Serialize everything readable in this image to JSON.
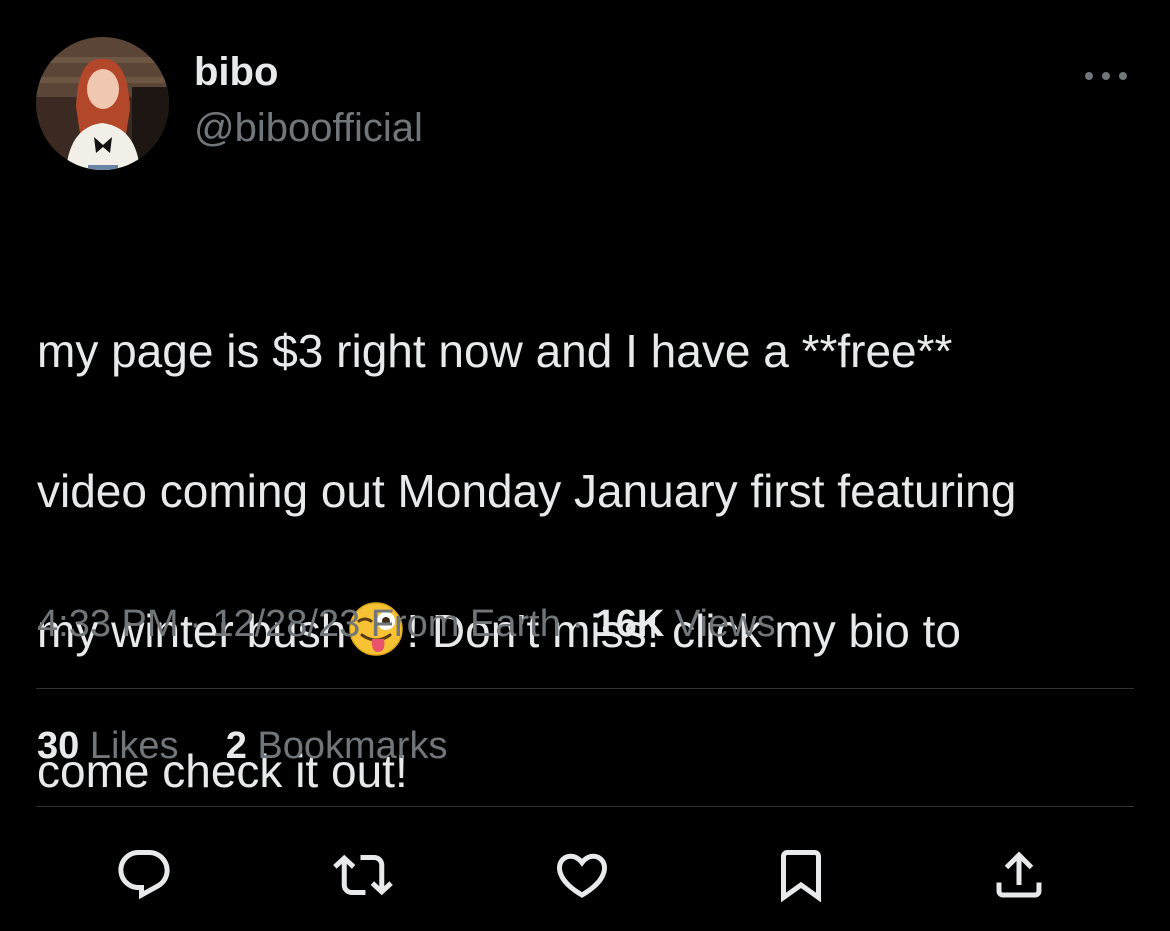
{
  "author": {
    "display_name": "bibo",
    "handle": "@biboofficial",
    "avatar_icon": "profile-photo"
  },
  "more_icon": "more-horizontal-icon",
  "tweet": {
    "line1": "my page is $3 right now and I have a **free**",
    "line2": "video coming out Monday January first featuring",
    "line3_before": "my winter bush",
    "emoji": "winking-face-with-tongue",
    "line3_after": "! Don’t miss! click my bio to",
    "line4": "come check it out!"
  },
  "meta": {
    "time": "4:33 PM",
    "sep1": " · ",
    "date": "12/28/23",
    "source": " From Earth",
    "sep2": " · ",
    "views_count": "16K",
    "views_label": " Views"
  },
  "stats": {
    "likes_count": "30",
    "likes_label": " Likes",
    "bookmarks_count": "2",
    "bookmarks_label": " Bookmarks"
  },
  "actions": [
    {
      "icon": "reply-icon"
    },
    {
      "icon": "retweet-icon"
    },
    {
      "icon": "like-icon"
    },
    {
      "icon": "bookmark-icon"
    },
    {
      "icon": "share-icon"
    }
  ],
  "colors": {
    "background": "#000000",
    "text": "#e7e9ea",
    "secondary": "#71767b",
    "divider": "#2f3336"
  }
}
